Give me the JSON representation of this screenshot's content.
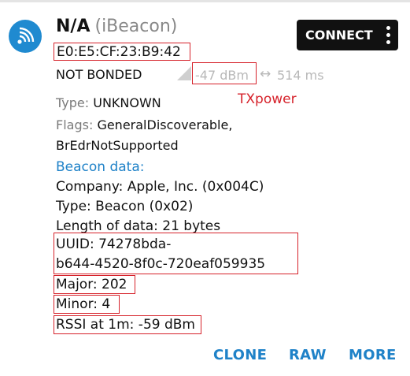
{
  "device": {
    "name": "N/A",
    "type_label": "(iBeacon)",
    "address": "E0:E5:CF:23:B9:42",
    "bond_state": "NOT BONDED",
    "tx_power": "-47 dBm",
    "interval": "514 ms",
    "connect_label": "CONNECT"
  },
  "annotation": {
    "tx_label": "TXpower"
  },
  "details": {
    "type_key": "Type:",
    "type_value": "UNKNOWN",
    "flags_key": "Flags:",
    "flags_value_1": "GeneralDiscoverable,",
    "flags_value_2": "BrEdrNotSupported",
    "beacon_header": "Beacon data:",
    "company": "Company: Apple, Inc. (0x004C)",
    "beacon_type": "Type: Beacon (0x02)",
    "length": "Length of data: 21 bytes",
    "uuid_1": "UUID: 74278bda-",
    "uuid_2": "b644-4520-8f0c-720eaf059935",
    "major": "Major: 202",
    "minor": "Minor: 4",
    "rssi": "RSSI at 1m: -59 dBm"
  },
  "actions": {
    "clone": "CLONE",
    "raw": "RAW",
    "more": "MORE"
  },
  "colors": {
    "accent": "#1f82c8",
    "annotation_red": "#d6222b",
    "button_bg": "#111111"
  }
}
